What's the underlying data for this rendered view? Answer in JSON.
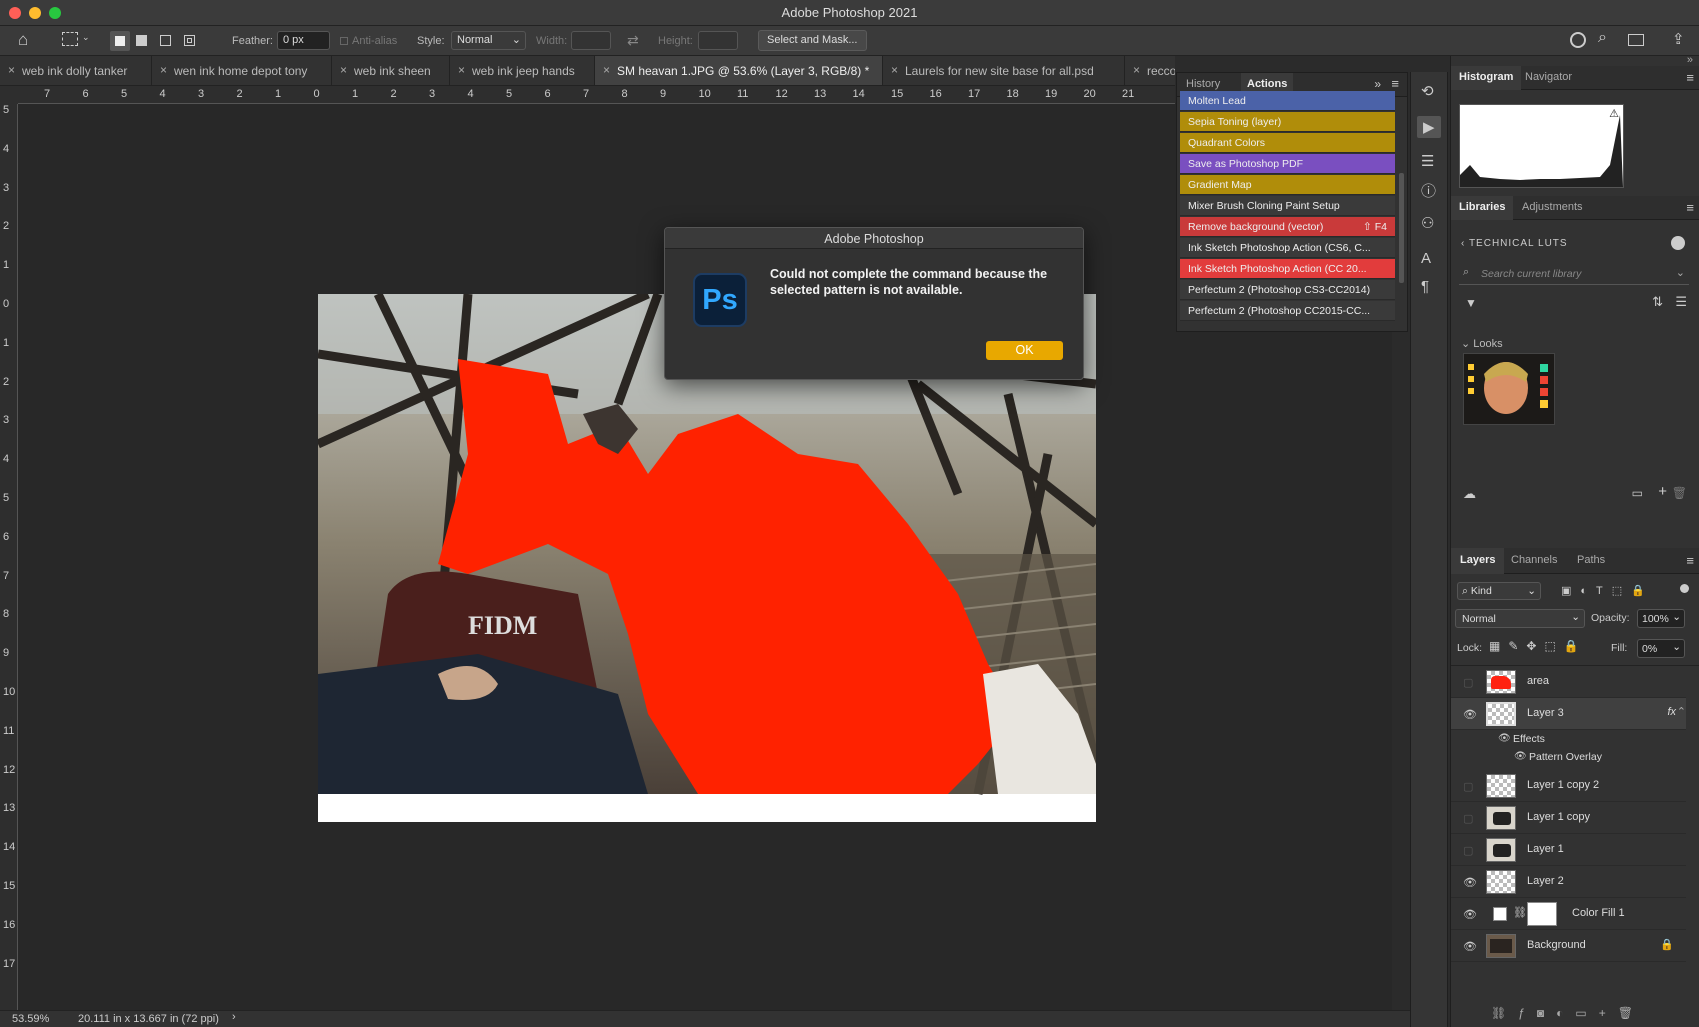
{
  "app": {
    "title": "Adobe Photoshop 2021"
  },
  "options": {
    "feather_label": "Feather:",
    "feather_value": "0 px",
    "antialias_label": "Anti-alias",
    "style_label": "Style:",
    "style_value": "Normal",
    "width_label": "Width:",
    "height_label": "Height:",
    "select_mask": "Select and Mask..."
  },
  "doc_tabs": [
    {
      "label": "web ink dolly tanker"
    },
    {
      "label": "wen ink home depot tony"
    },
    {
      "label": "web ink sheen"
    },
    {
      "label": "web ink jeep hands"
    },
    {
      "label": "SM heavan 1.JPG @ 53.6% (Layer 3, RGB/8) *"
    },
    {
      "label": "Laurels for new site base for all.psd"
    },
    {
      "label": "reccos"
    }
  ],
  "ruler": {
    "h": [
      "7",
      "6",
      "5",
      "4",
      "3",
      "2",
      "1",
      "0",
      "1",
      "2",
      "3",
      "4",
      "5",
      "6",
      "7",
      "8",
      "9",
      "10",
      "11",
      "12",
      "13",
      "14",
      "15",
      "16",
      "17",
      "18",
      "19",
      "20",
      "21"
    ],
    "v": [
      "5",
      "4",
      "3",
      "2",
      "1",
      "0",
      "1",
      "2",
      "3",
      "4",
      "5",
      "6",
      "7",
      "8",
      "9",
      "10",
      "11",
      "12",
      "13",
      "14",
      "15",
      "16",
      "17"
    ]
  },
  "status": {
    "zoom": "53.59%",
    "doc_size": "20.111 in x 13.667 in (72 ppi)"
  },
  "actions_panel": {
    "tab_history": "History",
    "tab_actions": "Actions",
    "items": [
      {
        "label": "Molten Lead",
        "color": "#4b62a8",
        "shortcut": ""
      },
      {
        "label": "Sepia Toning (layer)",
        "color": "#b08d0a",
        "shortcut": ""
      },
      {
        "label": "Quadrant Colors",
        "color": "#b08d0a",
        "shortcut": ""
      },
      {
        "label": "Save as Photoshop PDF",
        "color": "#7a4fc0",
        "shortcut": ""
      },
      {
        "label": "Gradient Map",
        "color": "#b08d0a",
        "shortcut": ""
      },
      {
        "label": "Mixer Brush Cloning Paint Setup",
        "color": "#3a3a3a",
        "shortcut": ""
      },
      {
        "label": "Remove background (vector)",
        "color": "#c93a3a",
        "shortcut": "⇧ F4"
      },
      {
        "label": "Ink Sketch Photoshop Action (CS6, C...",
        "color": "#3a3a3a",
        "shortcut": ""
      },
      {
        "label": "Ink Sketch Photoshop Action  (CC 20...",
        "color": "#e23c3c",
        "shortcut": ""
      },
      {
        "label": "Perfectum 2 (Photoshop CS3-CC2014)",
        "color": "#3a3a3a",
        "shortcut": ""
      },
      {
        "label": "Perfectum 2 (Photoshop CC2015-CC...",
        "color": "#3a3a3a",
        "shortcut": ""
      }
    ]
  },
  "dialog": {
    "title": "Adobe Photoshop",
    "logo": "Ps",
    "message": "Could not complete the command because the selected pattern is not available.",
    "ok": "OK"
  },
  "histogram": {
    "tab1": "Histogram",
    "tab2": "Navigator"
  },
  "libraries": {
    "tab1": "Libraries",
    "tab2": "Adjustments",
    "library_name": "TECHNICAL LUTS",
    "search_placeholder": "Search current library",
    "looks_label": "Looks"
  },
  "layers_panel": {
    "tab1": "Layers",
    "tab2": "Channels",
    "tab3": "Paths",
    "filter": "Kind",
    "blend": "Normal",
    "opacity_label": "Opacity:",
    "opacity": "100%",
    "lock_label": "Lock:",
    "fill_label": "Fill:",
    "fill": "0%",
    "layers": [
      {
        "name": "area",
        "visible": false
      },
      {
        "name": "Layer 3",
        "visible": true
      },
      {
        "name": "Layer 1 copy 2",
        "visible": false
      },
      {
        "name": "Layer 1 copy",
        "visible": false
      },
      {
        "name": "Layer 1",
        "visible": false
      },
      {
        "name": "Layer 2",
        "visible": true
      },
      {
        "name": "Color Fill 1",
        "visible": true
      },
      {
        "name": "Background",
        "visible": true
      }
    ],
    "effects_label": "Effects",
    "pattern_overlay": "Pattern Overlay",
    "fx": "fx"
  },
  "colors": {
    "accent_ok": "#e8a800",
    "ps_blue": "#31a8ff",
    "red_area": "#ff2200"
  }
}
